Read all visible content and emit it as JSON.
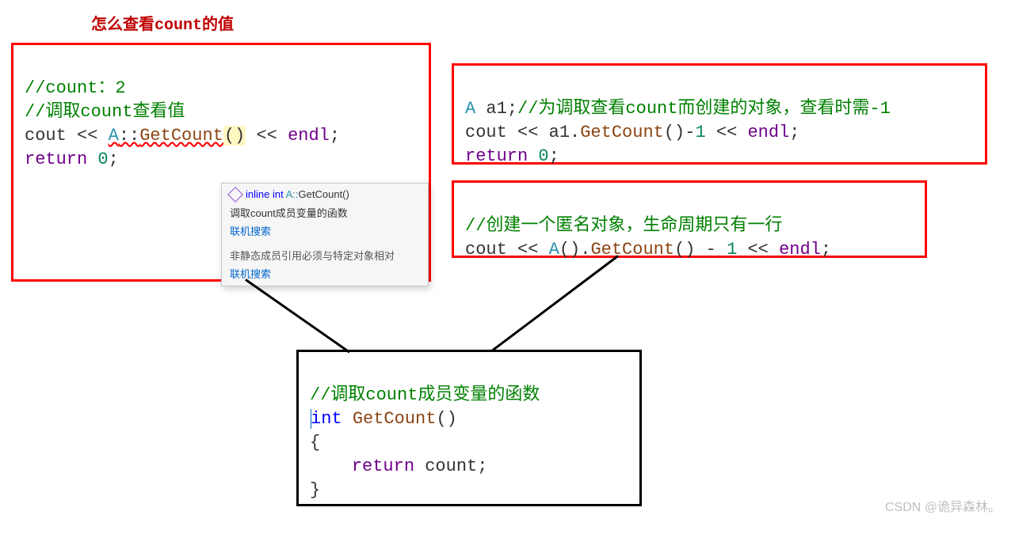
{
  "title": "怎么查看count的值",
  "watermark": "CSDN @诡异森林。",
  "box1": {
    "line1_comment": "//count：2",
    "line2_comment": "//调取count查看值",
    "line3_prefix": "cout << ",
    "line3_class": "A",
    "line3_sep": "::",
    "line3_fn": "GetCount",
    "line3_paren": "()",
    "line3_mid": " << ",
    "line3_endl": "endl",
    "line3_semi": ";",
    "line4_ret": "return",
    "line4_sp": " ",
    "line4_zero": "0",
    "line4_semi": ";"
  },
  "tooltip": {
    "sig_inline": "inline",
    "sig_int": "int",
    "sig_cls": "A::",
    "sig_fn": "GetCount()",
    "desc": "调取count成员变量的函数",
    "link": "联机搜索",
    "err": "非静态成员引用必须与特定对象相对"
  },
  "box2": {
    "l1_cls": "A",
    "l1_sp": " ",
    "l1_var": "a1",
    "l1_semi": ";",
    "l1_comment": "//为调取查看count而创建的对象，查看时需-1",
    "l2_pre": "cout << a1.",
    "l2_fn": "GetCount",
    "l2_after": "()-",
    "l2_one": "1",
    "l2_mid": " << ",
    "l2_endl": "endl",
    "l2_semi": ";",
    "l3_ret": "return",
    "l3_sp": " ",
    "l3_zero": "0",
    "l3_semi": ";"
  },
  "box3": {
    "l1_comment": "//创建一个匿名对象，生命周期只有一行",
    "l2_pre": "cout << ",
    "l2_cls": "A",
    "l2_after_cls": "().",
    "l2_fn": "GetCount",
    "l2_after_fn": "() - ",
    "l2_one": "1",
    "l2_mid": " << ",
    "l2_endl": "endl",
    "l2_semi": ";"
  },
  "box4": {
    "l1_comment": "//调取count成员变量的函数",
    "l2_int": "int",
    "l2_sp": " ",
    "l2_fn": "GetCount",
    "l2_paren": "()",
    "l3_open": "{",
    "l4_indent": "    ",
    "l4_ret": "return",
    "l4_sp": " ",
    "l4_var": "count",
    "l4_semi": ";",
    "l5_close": "}"
  }
}
